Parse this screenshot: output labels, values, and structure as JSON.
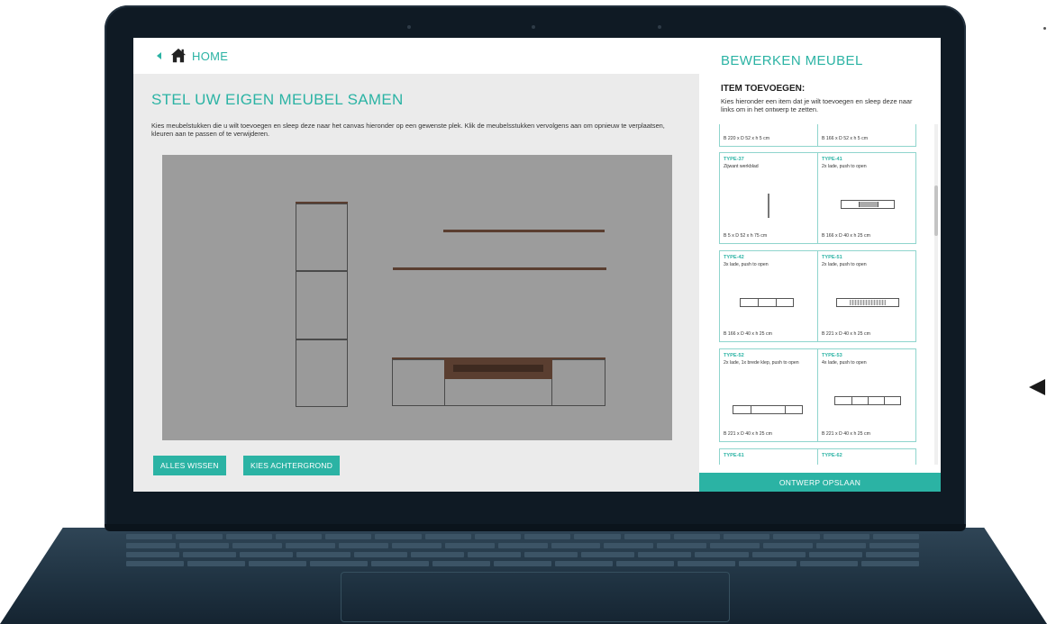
{
  "header": {
    "home_label": "HOME"
  },
  "main": {
    "title": "STEL UW EIGEN MEUBEL SAMEN",
    "description": "Kies meubelstukken die u wilt toevoegen en sleep deze naar het canvas hieronder op een gewenste plek. Klik de meubelsstukken vervolgens aan om opnieuw te verplaatsen, kleuren aan te passen of te verwijderen.",
    "buttons": {
      "clear": "ALLES WISSEN",
      "background": "KIES ACHTERGROND"
    }
  },
  "panel": {
    "title": "BEWERKEN MEUBEL",
    "subtitle": "ITEM TOEVOEGEN:",
    "description": "Kies hieronder een item dat je wilt toevoegen en sleep deze naar links om in het ontwerp te zetten.",
    "items": [
      {
        "type": "",
        "desc": "",
        "dims": "B 220 x D 52 x h 5 cm"
      },
      {
        "type": "",
        "desc": "",
        "dims": "B 166 x D 52 x h 5 cm"
      },
      {
        "type": "TYPE-37",
        "desc": "Zijwant werkblad",
        "dims": "B 5 x D 52 x h 75 cm"
      },
      {
        "type": "TYPE-41",
        "desc": "2x lade, push to open",
        "dims": "B 166 x D 40 x h 25 cm"
      },
      {
        "type": "TYPE-42",
        "desc": "3x lade, push to open",
        "dims": "B 166 x D 40 x h 25 cm"
      },
      {
        "type": "TYPE-51",
        "desc": "2x lade, push to open",
        "dims": "B 221 x D 40 x h 25 cm"
      },
      {
        "type": "TYPE-52",
        "desc": "2x lade, 1x brede klep, push to open",
        "dims": "B 221 x D 40 x h 25 cm"
      },
      {
        "type": "TYPE-53",
        "desc": "4x lade, push to open",
        "dims": "B 221 x D 40 x h 25 cm"
      },
      {
        "type": "TYPE-61",
        "desc": "",
        "dims": ""
      },
      {
        "type": "TYPE-62",
        "desc": "",
        "dims": ""
      }
    ],
    "save_label": "ONTWERP OPSLAAN"
  },
  "colors": {
    "accent": "#2bb3a4",
    "wood": "#5a3e30",
    "canvas": "#9c9c9c"
  },
  "icons": {
    "home": "home-icon",
    "back": "chevron-left-icon"
  }
}
